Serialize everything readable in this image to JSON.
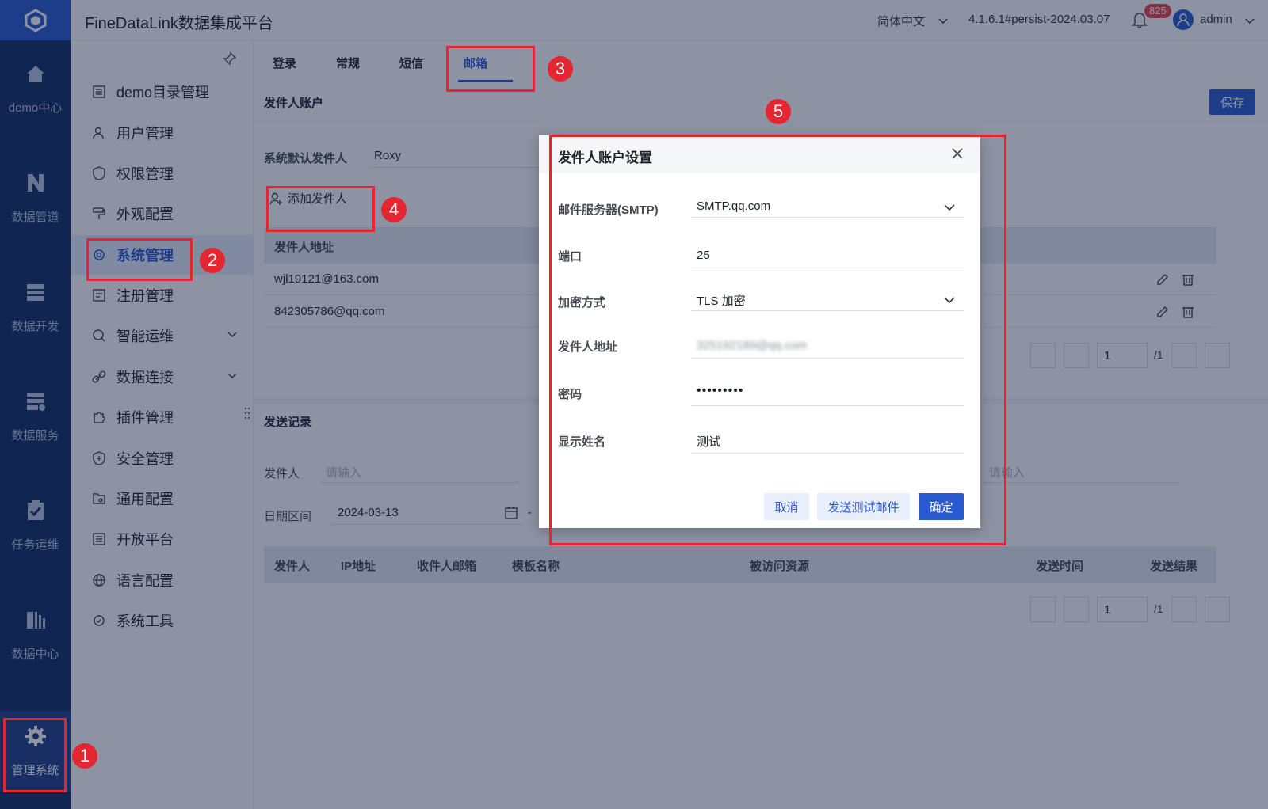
{
  "header": {
    "title": "FineDataLink数据集成平台",
    "language": "简体中文",
    "version": "4.1.6.1#persist-2024.03.07",
    "notification_count": "825",
    "user": "admin"
  },
  "rail": {
    "items": [
      {
        "label": "demo中心",
        "icon": "home-icon"
      },
      {
        "label": "数据管道",
        "icon": "pipeline-icon"
      },
      {
        "label": "数据开发",
        "icon": "dev-icon"
      },
      {
        "label": "数据服务",
        "icon": "service-icon"
      },
      {
        "label": "任务运维",
        "icon": "task-icon"
      },
      {
        "label": "数据中心",
        "icon": "datacenter-icon"
      },
      {
        "label": "管理系统",
        "icon": "gear-icon"
      }
    ]
  },
  "menu": {
    "items": [
      {
        "label": "demo目录管理"
      },
      {
        "label": "用户管理"
      },
      {
        "label": "权限管理"
      },
      {
        "label": "外观配置"
      },
      {
        "label": "系统管理"
      },
      {
        "label": "注册管理"
      },
      {
        "label": "智能运维"
      },
      {
        "label": "数据连接"
      },
      {
        "label": "插件管理"
      },
      {
        "label": "安全管理"
      },
      {
        "label": "通用配置"
      },
      {
        "label": "开放平台"
      },
      {
        "label": "语言配置"
      },
      {
        "label": "系统工具"
      }
    ]
  },
  "tabs": [
    "登录",
    "常规",
    "短信",
    "邮箱"
  ],
  "sender_section": {
    "title": "发件人账户",
    "save_label": "保存",
    "default_sender_label": "系统默认发件人",
    "default_sender_value": "Roxy",
    "add_sender_label": "添加发件人",
    "table_header": "发件人地址",
    "rows": [
      "wjl19121@163.com",
      "842305786@qq.com"
    ],
    "pager": {
      "page": "1",
      "total": "/1"
    }
  },
  "record_section": {
    "title": "发送记录",
    "sender_label": "发件人",
    "sender_placeholder": "请输入",
    "right_placeholder": "请输入",
    "date_label": "日期区间",
    "date_value": "2024-03-13",
    "date_sep": "-",
    "columns": [
      "发件人",
      "IP地址",
      "收件人邮箱",
      "模板名称",
      "被访问资源",
      "发送时间",
      "发送结果"
    ],
    "pager": {
      "page": "1",
      "total": "/1"
    }
  },
  "modal": {
    "title": "发件人账户设置",
    "smtp_label": "邮件服务器(SMTP)",
    "smtp_value": "SMTP.qq.com",
    "port_label": "端口",
    "port_value": "25",
    "encrypt_label": "加密方式",
    "encrypt_value": "TLS 加密",
    "address_label": "发件人地址",
    "address_value": "325192189@qq.com",
    "password_label": "密码",
    "password_value": "•••••••••",
    "display_label": "显示姓名",
    "display_value": "测试",
    "cancel_label": "取消",
    "test_label": "发送测试邮件",
    "ok_label": "确定"
  },
  "annotations": [
    "1",
    "2",
    "3",
    "4",
    "5"
  ],
  "colors": {
    "primary": "#2a5ad0",
    "rail": "#102c63",
    "annotation": "#e3262f"
  }
}
